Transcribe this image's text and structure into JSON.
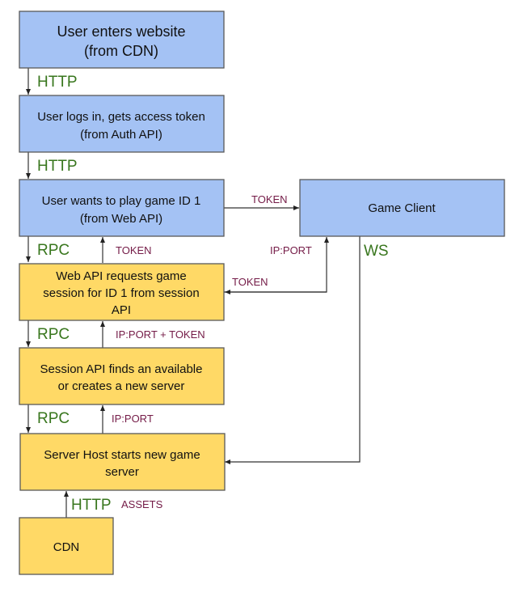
{
  "colors": {
    "client_box": "#a4c2f4",
    "server_box": "#ffd966",
    "protocol_label": "#38761d",
    "payload_label": "#741b47"
  },
  "nodes": {
    "enter": [
      "User enters website",
      "(from CDN)"
    ],
    "login": [
      "User logs in, gets access token",
      "(from Auth API)"
    ],
    "play": [
      "User wants to play game ID 1",
      "(from Web API)"
    ],
    "webapi": [
      "Web API requests game",
      "session for ID 1 from session",
      "API"
    ],
    "session": [
      "Session API finds an available",
      "or creates a new server"
    ],
    "host": [
      "Server Host starts new game",
      "server"
    ],
    "cdn": [
      "CDN"
    ],
    "client": [
      "Game Client"
    ]
  },
  "edges": {
    "http1": "HTTP",
    "http2": "HTTP",
    "rpc1": "RPC",
    "token_up1": "TOKEN",
    "token_client": "TOKEN",
    "ipport_client": "IP:PORT",
    "token_webapi": "TOKEN",
    "ws": "WS",
    "rpc2": "RPC",
    "ipport_token": "IP:PORT + TOKEN",
    "rpc3": "RPC",
    "ipport_up": "IP:PORT",
    "http_cdn": "HTTP",
    "assets": "ASSETS"
  }
}
